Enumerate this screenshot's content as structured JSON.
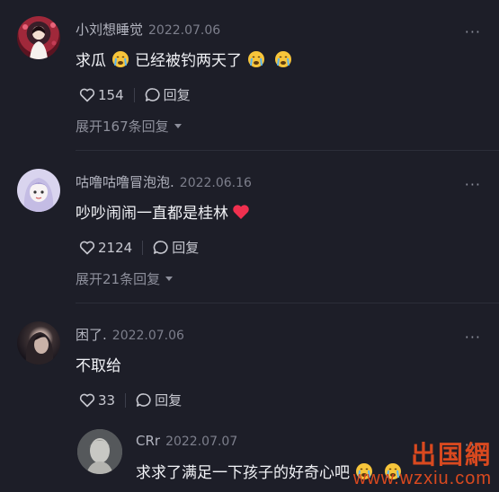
{
  "comments": [
    {
      "username": "小刘想睡觉",
      "date": "2022.07.06",
      "text": "求瓜",
      "text_after_emoji": "已经被钓两天了",
      "likes": "154",
      "reply_label": "回复",
      "expand_label": "展开167条回复",
      "more": "···"
    },
    {
      "username": "咕噜咕噜冒泡泡.",
      "date": "2022.06.16",
      "text": "吵吵闹闹一直都是桂林",
      "likes": "2124",
      "reply_label": "回复",
      "expand_label": "展开21条回复",
      "more": "···"
    },
    {
      "username": "困了.",
      "date": "2022.07.06",
      "text": "不取给",
      "likes": "33",
      "reply_label": "回复",
      "more": "···"
    }
  ],
  "reply": {
    "username": "CRr",
    "date": "2022.07.07",
    "text": "求求了满足一下孩子的好奇心吧",
    "more": "···"
  },
  "watermark": {
    "logo": "出国網",
    "url": "www.wzxiu.com"
  },
  "colors": {
    "background": "#1d1e28",
    "username": "#b2b4bf",
    "heart": "#f0304f",
    "watermark": "#d9491f"
  },
  "icons": [
    "heart-outline-icon",
    "comment-bubble-icon",
    "crying-face-emoji",
    "red-heart-emoji",
    "more-icon",
    "caret-down-icon"
  ]
}
